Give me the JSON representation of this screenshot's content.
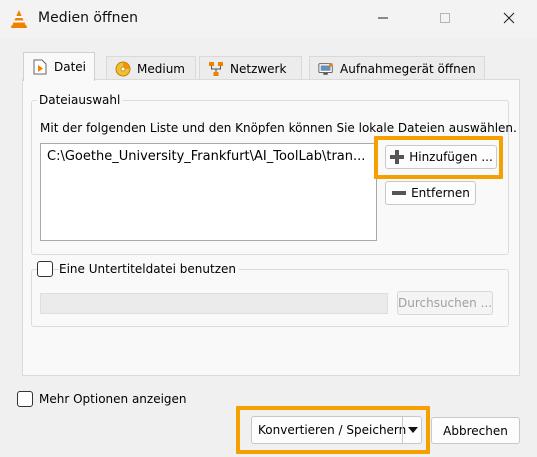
{
  "window": {
    "title": "Medien öffnen"
  },
  "tabs": [
    {
      "label": "Datei",
      "active": true
    },
    {
      "label": "Medium",
      "active": false
    },
    {
      "label": "Netzwerk",
      "active": false
    },
    {
      "label": "Aufnahmegerät öffnen",
      "active": false
    }
  ],
  "file_group": {
    "legend": "Dateiauswahl",
    "description": "Mit der folgenden Liste und den Knöpfen können Sie lokale Dateien auswählen.",
    "files": [
      "C:\\Goethe_University_Frankfurt\\AI_ToolLab\\tran..."
    ],
    "add_label": "Hinzufügen ...",
    "remove_label": "Entfernen"
  },
  "subtitle_group": {
    "checkbox_label": "Eine Untertiteldatei benutzen",
    "checked": false,
    "browse_label": "Durchsuchen ...",
    "path_value": ""
  },
  "more_options": {
    "label": "Mehr Optionen anzeigen",
    "checked": false
  },
  "footer": {
    "convert_label": "Konvertieren / Speichern",
    "cancel_label": "Abbrechen"
  },
  "colors": {
    "highlight": "#f5a000",
    "vlc_orange": "#f08000"
  }
}
